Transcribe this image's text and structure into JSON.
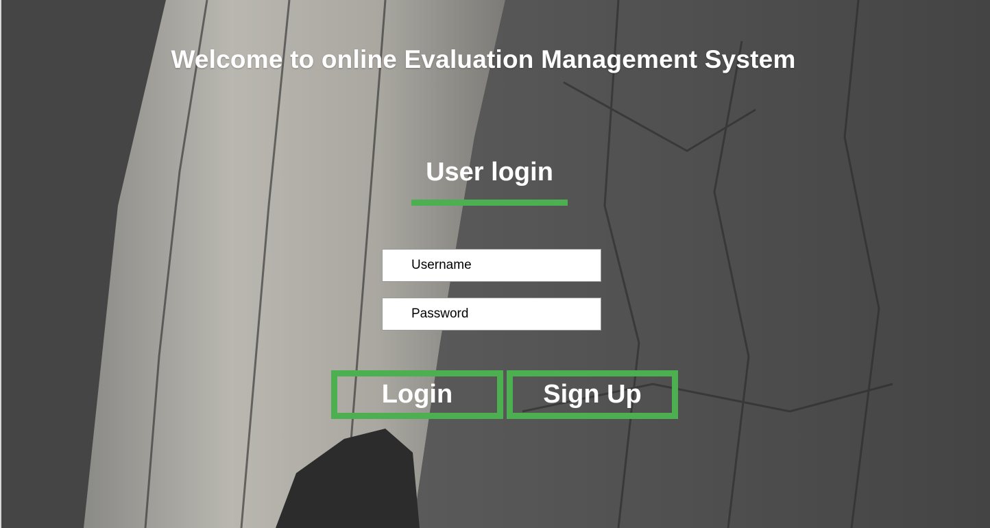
{
  "page": {
    "title": "Welcome to online Evaluation Management System"
  },
  "login_form": {
    "heading": "User login",
    "username_placeholder": "Username",
    "password_placeholder": "Password",
    "login_label": "Login",
    "signup_label": "Sign Up"
  },
  "colors": {
    "accent": "#4caf50",
    "text": "#ffffff",
    "input_background": "#ffffff"
  }
}
